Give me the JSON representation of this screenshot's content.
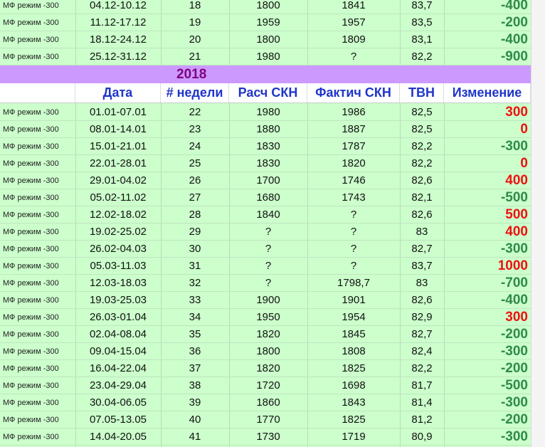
{
  "colors": {
    "positive": "#ee1111",
    "negative": "#2f8a4b",
    "header_text": "#1f35c8",
    "year_text": "#7f007f",
    "year_band": "#cc99ff",
    "sheet_bg": "#ccffcc"
  },
  "top_rows": [
    {
      "mode": "МФ режим -300",
      "date": "04.12-10.12",
      "week": "18",
      "calc": "1800",
      "fact": "1841",
      "tvn": "83,7",
      "change": "-400"
    },
    {
      "mode": "МФ режим -300",
      "date": "11.12-17.12",
      "week": "19",
      "calc": "1959",
      "fact": "1957",
      "tvn": "83,5",
      "change": "-200"
    },
    {
      "mode": "МФ режим -300",
      "date": "18.12-24.12",
      "week": "20",
      "calc": "1800",
      "fact": "1809",
      "tvn": "83,1",
      "change": "-400"
    },
    {
      "mode": "МФ режим -300",
      "date": "25.12-31.12",
      "week": "21",
      "calc": "1980",
      "fact": "?",
      "tvn": "82,2",
      "change": "-900"
    }
  ],
  "year_label": "2018",
  "headers": {
    "mode": "",
    "date": "Дата",
    "week": "# недели",
    "calc": "Расч СКН",
    "fact": "Фактич СКН",
    "tvn": "ТВН",
    "change": "Изменение"
  },
  "rows": [
    {
      "mode": "МФ режим -300",
      "date": "01.01-07.01",
      "week": "22",
      "calc": "1980",
      "fact": "1986",
      "tvn": "82,5",
      "change": "300"
    },
    {
      "mode": "МФ режим -300",
      "date": "08.01-14.01",
      "week": "23",
      "calc": "1880",
      "fact": "1887",
      "tvn": "82,5",
      "change": "0"
    },
    {
      "mode": "МФ режим -300",
      "date": "15.01-21.01",
      "week": "24",
      "calc": "1830",
      "fact": "1787",
      "tvn": "82,2",
      "change": "-300"
    },
    {
      "mode": "МФ режим -300",
      "date": "22.01-28.01",
      "week": "25",
      "calc": "1830",
      "fact": "1820",
      "tvn": "82,2",
      "change": "0"
    },
    {
      "mode": "МФ режим -300",
      "date": "29.01-04.02",
      "week": "26",
      "calc": "1700",
      "fact": "1746",
      "tvn": "82,6",
      "change": "400"
    },
    {
      "mode": "МФ режим -300",
      "date": "05.02-11.02",
      "week": "27",
      "calc": "1680",
      "fact": "1743",
      "tvn": "82,1",
      "change": "-500"
    },
    {
      "mode": "МФ режим -300",
      "date": "12.02-18.02",
      "week": "28",
      "calc": "1840",
      "fact": "?",
      "tvn": "82,6",
      "change": "500"
    },
    {
      "mode": "МФ режим -300",
      "date": "19.02-25.02",
      "week": "29",
      "calc": "?",
      "fact": "?",
      "tvn": "83",
      "change": "400"
    },
    {
      "mode": "МФ режим -300",
      "date": "26.02-04.03",
      "week": "30",
      "calc": "?",
      "fact": "?",
      "tvn": "82,7",
      "change": "-300"
    },
    {
      "mode": "МФ режим -300",
      "date": "05.03-11.03",
      "week": "31",
      "calc": "?",
      "fact": "?",
      "tvn": "83,7",
      "change": "1000"
    },
    {
      "mode": "МФ режим -300",
      "date": "12.03-18.03",
      "week": "32",
      "calc": "?",
      "fact": "1798,7",
      "tvn": "83",
      "change": "-700"
    },
    {
      "mode": "МФ режим -300",
      "date": "19.03-25.03",
      "week": "33",
      "calc": "1900",
      "fact": "1901",
      "tvn": "82,6",
      "change": "-400"
    },
    {
      "mode": "МФ режим -300",
      "date": "26.03-01.04",
      "week": "34",
      "calc": "1950",
      "fact": "1954",
      "tvn": "82,9",
      "change": "300"
    },
    {
      "mode": "МФ режим -300",
      "date": "02.04-08.04",
      "week": "35",
      "calc": "1820",
      "fact": "1845",
      "tvn": "82,7",
      "change": "-200"
    },
    {
      "mode": "МФ режим -300",
      "date": "09.04-15.04",
      "week": "36",
      "calc": "1800",
      "fact": "1808",
      "tvn": "82,4",
      "change": "-300"
    },
    {
      "mode": "МФ режим -300",
      "date": "16.04-22.04",
      "week": "37",
      "calc": "1820",
      "fact": "1825",
      "tvn": "82,2",
      "change": "-200"
    },
    {
      "mode": "МФ режим -300",
      "date": "23.04-29.04",
      "week": "38",
      "calc": "1720",
      "fact": "1698",
      "tvn": "81,7",
      "change": "-500"
    },
    {
      "mode": "МФ режим -300",
      "date": "30.04-06.05",
      "week": "39",
      "calc": "1860",
      "fact": "1843",
      "tvn": "81,4",
      "change": "-300"
    },
    {
      "mode": "МФ режим -300",
      "date": "07.05-13.05",
      "week": "40",
      "calc": "1770",
      "fact": "1825",
      "tvn": "81,2",
      "change": "-200"
    },
    {
      "mode": "МФ режим -300",
      "date": "14.04-20.05",
      "week": "41",
      "calc": "1730",
      "fact": "1719",
      "tvn": "80,9",
      "change": "-300"
    }
  ]
}
